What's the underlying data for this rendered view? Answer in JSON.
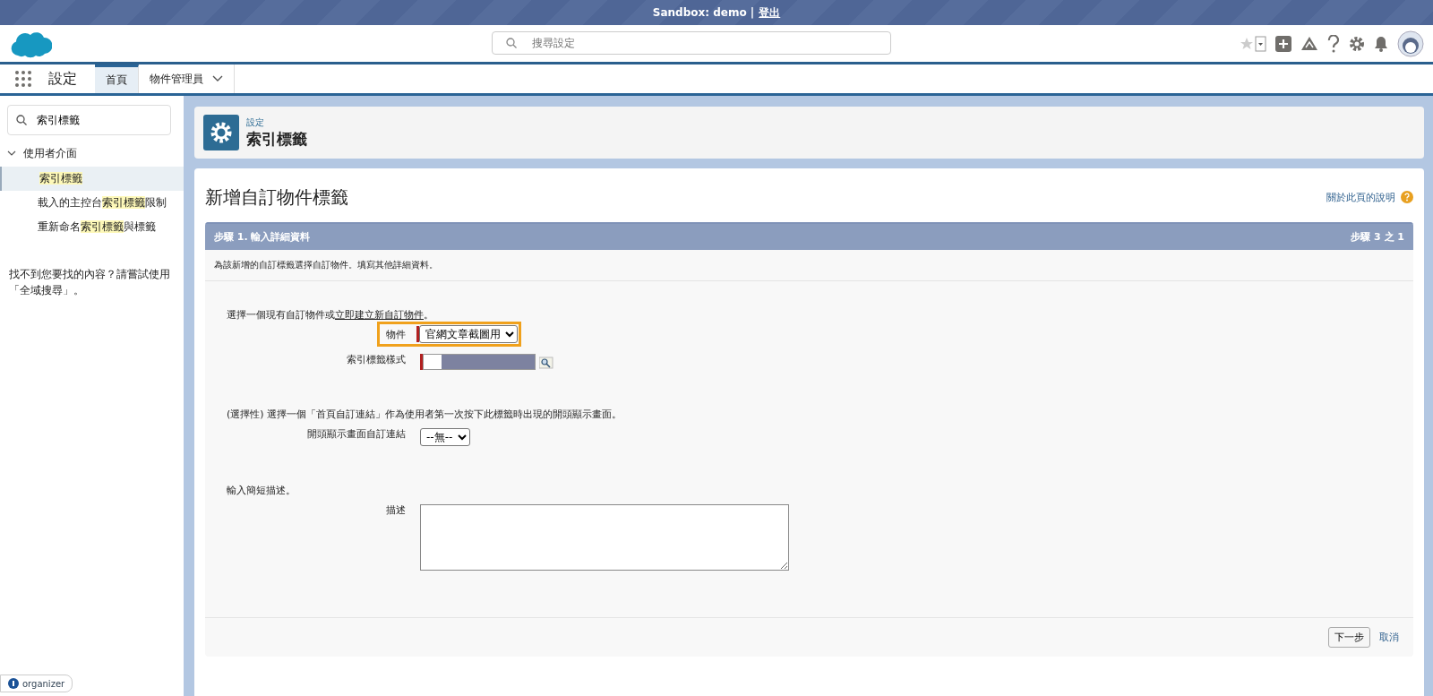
{
  "top_bar": {
    "org": "Sandbox: demo |",
    "logout": "登出"
  },
  "header": {
    "search": {
      "placeholder": "搜尋設定"
    }
  },
  "nav": {
    "app_name": "設定",
    "tabs": [
      {
        "label": "首頁",
        "selected": true,
        "has_menu": false
      },
      {
        "label": "物件管理員",
        "selected": false,
        "has_menu": true
      }
    ]
  },
  "sidebar": {
    "search": {
      "value": "索引標籤"
    },
    "items": [
      {
        "label": "使用者介面",
        "expanded": true,
        "children": [
          {
            "parts": [
              {
                "text": "索引標籤",
                "highlighted": true
              }
            ],
            "selected": true
          },
          {
            "parts": [
              {
                "text": "載入的主控台",
                "highlighted": false
              },
              {
                "text": "索引標籤",
                "highlighted": true
              },
              {
                "text": "限制",
                "highlighted": false
              }
            ],
            "selected": false
          },
          {
            "parts": [
              {
                "text": "重新命名",
                "highlighted": false
              },
              {
                "text": "索引標籤",
                "highlighted": true
              },
              {
                "text": "與標籤",
                "highlighted": false
              }
            ],
            "selected": false
          }
        ]
      }
    ],
    "hint": "找不到您要找的內容？請嘗試使用「全域搜尋」。",
    "organizer": "organizer"
  },
  "page_header": {
    "breadcrumb": "設定",
    "title": "索引標籤"
  },
  "content": {
    "title": "新增自訂物件標籤",
    "help_link": "關於此頁的說明",
    "step": {
      "title": "步驟 1. 輸入詳細資料",
      "counter": "步驟 3 之 1",
      "intro": "為該新增的自訂標籤選擇自訂物件。填寫其他詳細資料。",
      "sections": [
        {
          "lead": "選擇一個現有自訂物件或",
          "lead_link": "立即建立新自訂物件",
          "lead_end": "。",
          "fields": [
            {
              "kind": "select",
              "label": "物件",
              "value": "官網文章截圖用",
              "required": true,
              "highlighted": true
            },
            {
              "kind": "style",
              "label": "索引標籤樣式",
              "required": true,
              "highlighted": false
            }
          ]
        },
        {
          "lead": "(選擇性) 選擇一個「首頁自訂連結」作為使用者第一次按下此標籤時出現的開頭顯示畫面。",
          "fields": [
            {
              "kind": "select",
              "label": "開頭顯示畫面自訂連結",
              "value": "--無--",
              "required": false,
              "highlighted": false
            }
          ]
        },
        {
          "lead": "輸入簡短描述。",
          "fields": [
            {
              "kind": "textarea",
              "label": "描述",
              "required": false,
              "highlighted": false
            }
          ]
        }
      ],
      "buttons": {
        "next": "下一步",
        "cancel": "取消"
      }
    }
  }
}
